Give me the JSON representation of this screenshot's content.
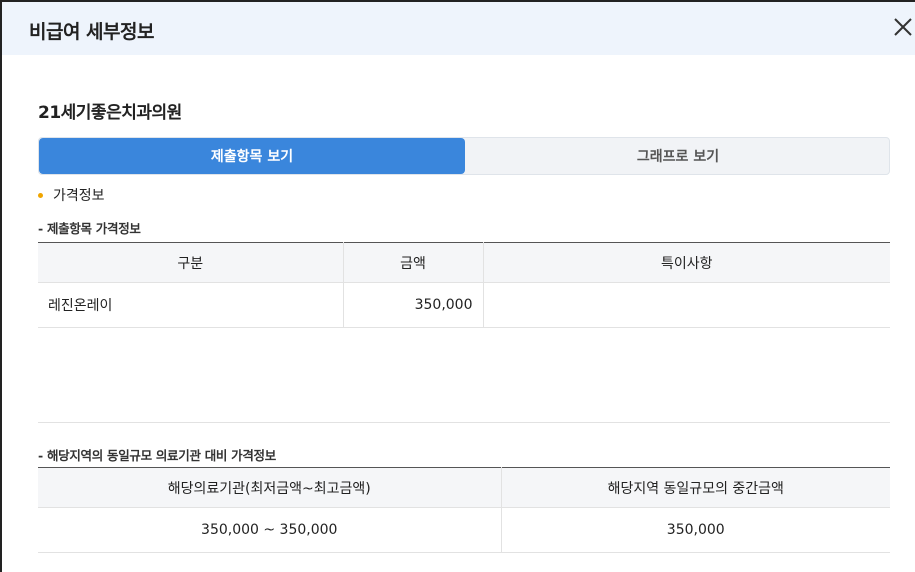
{
  "modal": {
    "title": "비급여 세부정보"
  },
  "clinic": {
    "name": "21세기좋은치과의원"
  },
  "tabs": [
    {
      "label": "제출항목 보기",
      "active": true
    },
    {
      "label": "그래프로 보기",
      "active": false
    }
  ],
  "section": {
    "title": "가격정보"
  },
  "submitted": {
    "heading": "- 제출항목 가격정보",
    "columns": [
      "구분",
      "금액",
      "특이사항"
    ],
    "rows": [
      {
        "category": "레진온레이",
        "amount": "350,000",
        "note": ""
      }
    ]
  },
  "regional": {
    "heading": "- 해당지역의 동일규모 의료기관 대비 가격정보",
    "columns": [
      "해당의료기관(최저금액~최고금액)",
      "해당지역 동일규모의 중간금액"
    ],
    "rows": [
      {
        "range": "350,000 ~ 350,000",
        "median": "350,000"
      }
    ]
  },
  "colors": {
    "accent": "#3a86dc",
    "bullet": "#f0a500",
    "header_bg": "#eef4fc"
  }
}
